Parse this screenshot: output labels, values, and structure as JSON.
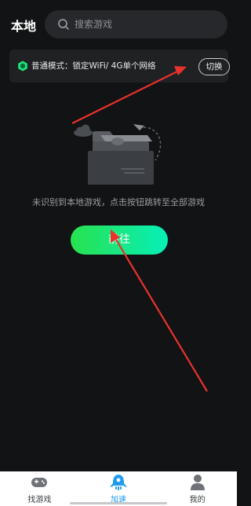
{
  "header": {
    "title": "本地",
    "search_placeholder": "搜索游戏"
  },
  "mode_bar": {
    "text": "普通模式：锁定WiFi/ 4G单个网络",
    "switch_label": "切换"
  },
  "empty_state": {
    "message": "未识别到本地游戏，点击按钮跳转至全部游戏",
    "button_label": "前往"
  },
  "tabbar": {
    "tabs": [
      {
        "label": "找游戏",
        "icon": "gamepad-icon",
        "active": false
      },
      {
        "label": "加速",
        "icon": "rocket-icon",
        "active": true
      },
      {
        "label": "我的",
        "icon": "user-icon",
        "active": false
      }
    ]
  },
  "colors": {
    "background": "#121314",
    "accent_green": "#17e889",
    "active_tab": "#1f9cf0",
    "annotation_arrow": "#e8322b"
  }
}
